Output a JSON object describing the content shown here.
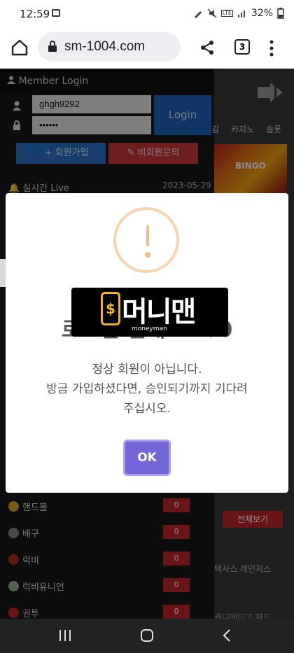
{
  "status_bar": {
    "time": "12:59",
    "lte_label": "LTE",
    "battery": "32%"
  },
  "browser": {
    "url": "sm-1004.com",
    "tab_count": "3"
  },
  "sidebar": {
    "title": "Member Login",
    "username": "ghgh9292",
    "password_mask": "••••••",
    "login_label": "Login",
    "join_label": "회원가입",
    "guest_inquiry_label": "비회원문의",
    "live_label": "실시간 Live",
    "live_date": "2023-05-29",
    "sports": [
      {
        "name": "핸드볼",
        "count": "0"
      },
      {
        "name": "배구",
        "count": "0"
      },
      {
        "name": "럭비",
        "count": "0"
      },
      {
        "name": "럭비유니언",
        "count": "0"
      },
      {
        "name": "권투",
        "count": "0"
      }
    ]
  },
  "right_panel": {
    "nav_items": [
      "김",
      "카지노",
      "슬롯"
    ],
    "banner_text": "BINGO",
    "view_all_label": "전체보기",
    "text_1": "텍사스 레인저스",
    "text_2": "캐디에이고 파드"
  },
  "modal": {
    "title": "로그인 실패 - 100",
    "message_lines": [
      "정상 회원이 아닙니다.",
      "방금 가입하셨다면, 승인되기까지 기다려",
      "주십시오."
    ],
    "ok_label": "OK"
  },
  "watermark": {
    "brand": "머니맨",
    "sub": "moneyman"
  },
  "colors": {
    "login_blue": "#1e63b8",
    "alert_red": "#c0272d",
    "ok_purple": "#7367d8",
    "warn_orange": "#f5ba86"
  }
}
